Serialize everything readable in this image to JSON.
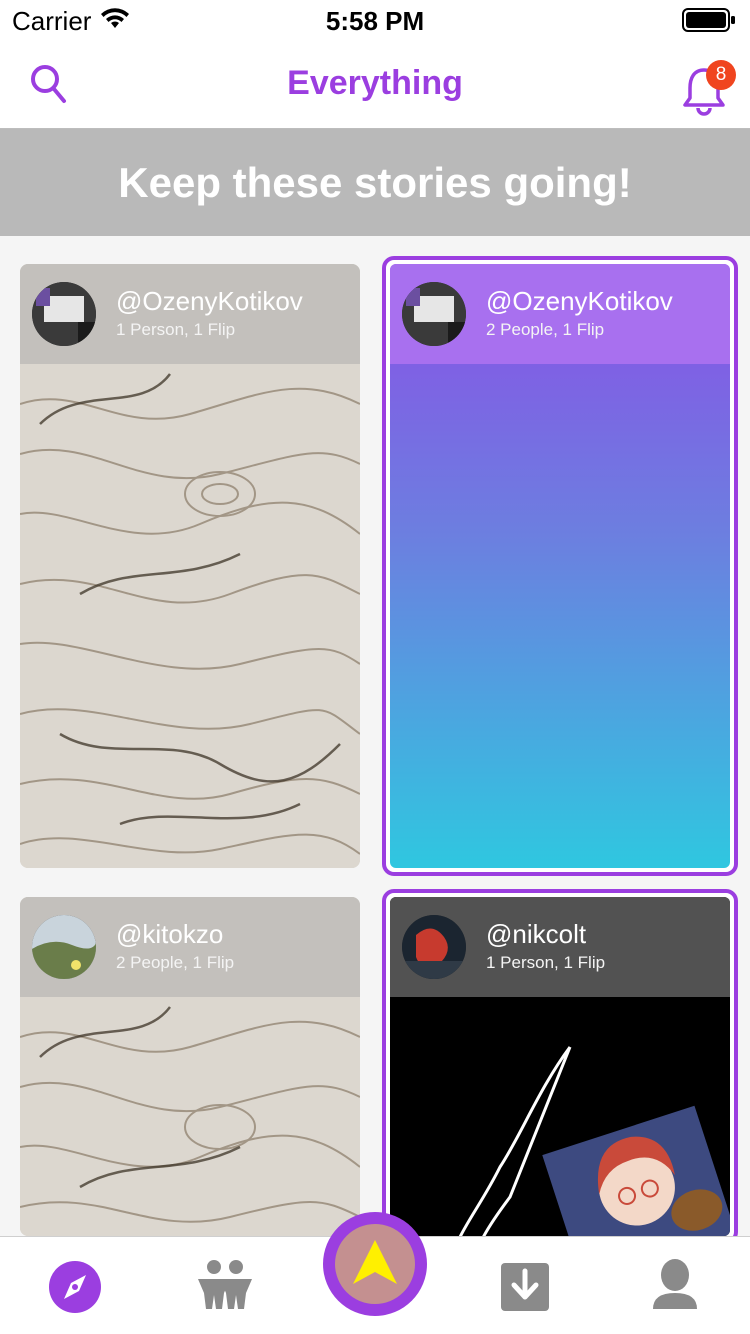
{
  "status_bar": {
    "carrier": "Carrier",
    "time": "5:58 PM"
  },
  "nav": {
    "title": "Everything",
    "notification_count": "8"
  },
  "banner": {
    "text": "Keep these stories going!"
  },
  "cards": [
    {
      "username": "@OzenyKotikov",
      "meta": "1 Person, 1 Flip",
      "selected": false
    },
    {
      "username": "@OzenyKotikov",
      "meta": "2 People, 1 Flip",
      "selected": true
    },
    {
      "username": "@kitokzo",
      "meta": "2 People, 1 Flip",
      "selected": false
    },
    {
      "username": "@nikcolt",
      "meta": "1 Person, 1 Flip",
      "selected": true
    }
  ],
  "tab_bar": {
    "tabs": [
      "explore-icon",
      "people-icon",
      "create-icon",
      "download-icon",
      "profile-icon"
    ],
    "active": "explore-icon"
  },
  "colors": {
    "accent": "#9b3ee0",
    "badge": "#f0451f",
    "banner": "#b9b9b9",
    "create_arrow": "#fff000"
  }
}
